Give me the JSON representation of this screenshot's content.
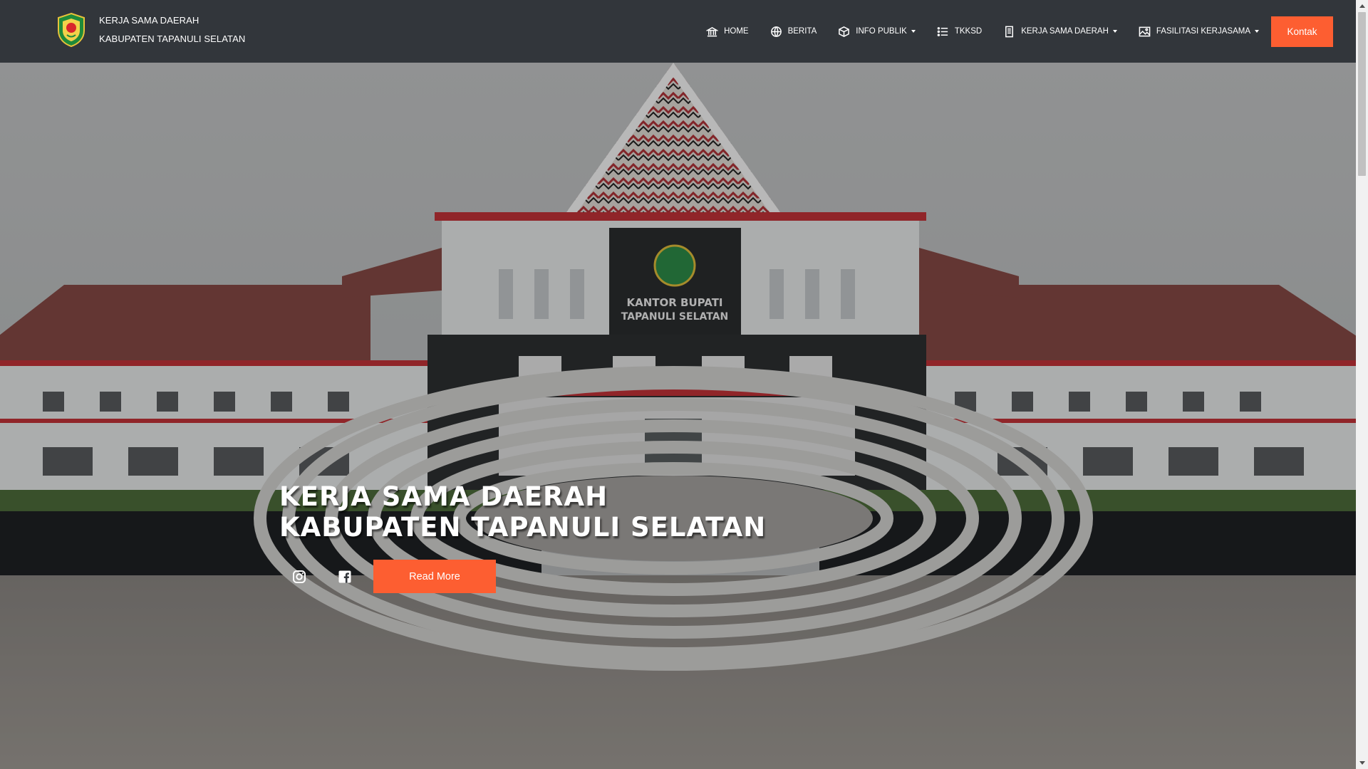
{
  "brand": {
    "line1": "KERJA SAMA DAERAH",
    "line2": "KABUPATEN TAPANULI SELATAN",
    "logo_icon": "regency-emblem-icon"
  },
  "nav": {
    "items": [
      {
        "label": "HOME",
        "icon": "bank-icon",
        "dropdown": false
      },
      {
        "label": "BERITA",
        "icon": "globe-icon",
        "dropdown": false
      },
      {
        "label": "INFO PUBLIK",
        "icon": "box-icon",
        "dropdown": true
      },
      {
        "label": "TKKSD",
        "icon": "list-icon",
        "dropdown": false
      },
      {
        "label": "KERJA SAMA DAERAH",
        "icon": "document-icon",
        "dropdown": true
      },
      {
        "label": "FASILITASI KERJASAMA",
        "icon": "image-icon",
        "dropdown": true
      }
    ],
    "cta_label": "Kontak"
  },
  "hero": {
    "title_line1": "KERJA SAMA DAERAH",
    "title_line2": "KABUPATEN TAPANULI SELATAN",
    "building_sign_line1": "KANTOR BUPATI",
    "building_sign_line2": "TAPANULI SELATAN",
    "social": [
      "instagram-icon",
      "facebook-icon"
    ],
    "read_more_label": "Read More"
  },
  "colors": {
    "navbar_bg": "#32363b",
    "accent": "#fd5e31",
    "text": "#ffffff"
  }
}
